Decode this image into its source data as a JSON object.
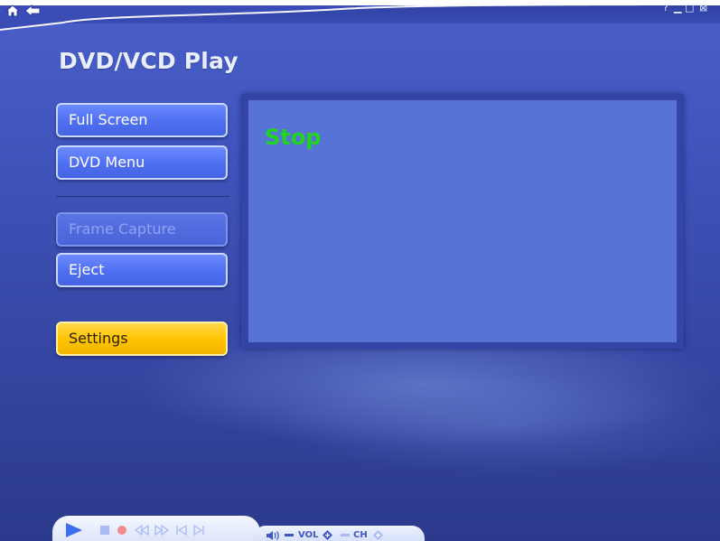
{
  "window": {
    "title": "DVD/VCD Play",
    "controls": {
      "help": "?",
      "minimize": "▁",
      "maximize": "□",
      "close": "⊠"
    }
  },
  "nav": {
    "home_icon": "home-icon",
    "back_icon": "back-arrow-icon"
  },
  "menu": {
    "full_screen": "Full Screen",
    "dvd_menu": "DVD Menu",
    "frame_capture": "Frame Capture",
    "eject": "Eject",
    "settings": "Settings"
  },
  "player": {
    "status": "Stop"
  },
  "transport": {
    "vol_label": "VOL",
    "ch_label": "CH",
    "icons": [
      "play-icon",
      "stop-icon",
      "record-icon",
      "rewind-icon",
      "fast-forward-icon",
      "previous-track-icon",
      "next-track-icon",
      "speaker-icon",
      "volume-down-icon",
      "volume-up-icon",
      "channel-down-icon",
      "channel-up-icon"
    ]
  },
  "colors": {
    "background": "#3f53bb",
    "button": "#5575f0",
    "settings_button": "#ffc400",
    "status_text": "#1fd51f",
    "video_area": "#5873d6"
  }
}
